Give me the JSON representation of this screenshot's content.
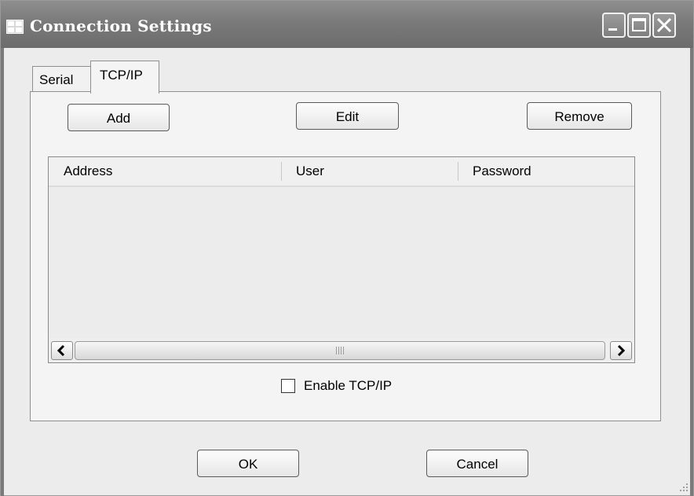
{
  "window": {
    "title": "Connection Settings",
    "controls": [
      "minimize-icon",
      "maximize-icon",
      "close-icon"
    ]
  },
  "tabs": [
    {
      "label": "Serial",
      "active": false
    },
    {
      "label": "TCP/IP",
      "active": true
    }
  ],
  "toolbar": {
    "add_label": "Add",
    "edit_label": "Edit",
    "remove_label": "Remove"
  },
  "table": {
    "columns": [
      "Address",
      "User",
      "Password"
    ],
    "rows": []
  },
  "enable_checkbox": {
    "label": "Enable TCP/IP",
    "checked": false
  },
  "footer": {
    "ok_label": "OK",
    "cancel_label": "Cancel"
  }
}
